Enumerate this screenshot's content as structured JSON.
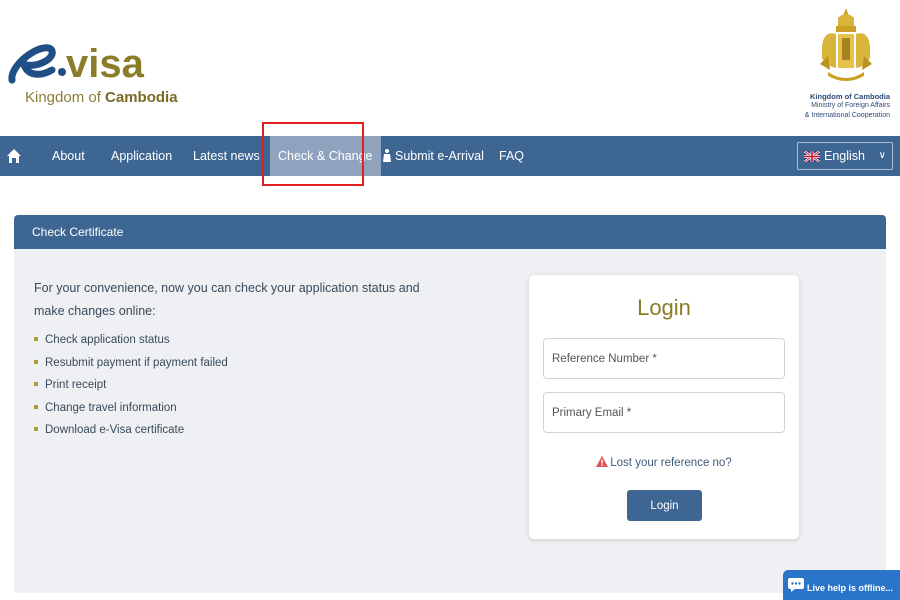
{
  "header": {
    "logo_main": "e.visa",
    "logo_sub_prefix": "Kingdom of ",
    "logo_sub_bold": "Cambodia",
    "gov_title": "Kingdom of Cambodia",
    "gov_ministry": "Ministry of Foreign Affairs",
    "gov_cooperation": "& International Cooperation"
  },
  "nav": {
    "home_icon": "home-icon",
    "items": [
      {
        "label": "About"
      },
      {
        "label": "Application"
      },
      {
        "label": "Latest news"
      },
      {
        "label": "Check & Change",
        "active": true
      },
      {
        "label": "Submit e-Arrival",
        "icon": "traveler-icon"
      },
      {
        "label": "FAQ"
      }
    ],
    "language": {
      "selected": "English",
      "flag": "uk-flag-icon"
    }
  },
  "panel": {
    "title": "Check Certificate",
    "intro": "For your convenience, now you can check your application status and make changes online:",
    "features": [
      "Check application status",
      "Resubmit payment if payment failed",
      "Print receipt",
      "Change travel information",
      "Download e-Visa certificate"
    ]
  },
  "login": {
    "title": "Login",
    "reference_placeholder": "Reference Number *",
    "email_placeholder": "Primary Email *",
    "lost_link": "Lost your reference no?",
    "button": "Login"
  },
  "livehelp": {
    "label": "Live help is offline..."
  },
  "colors": {
    "nav_bg": "#3e6692",
    "accent_gold": "#8a7d2a",
    "highlight": "#e02020"
  }
}
